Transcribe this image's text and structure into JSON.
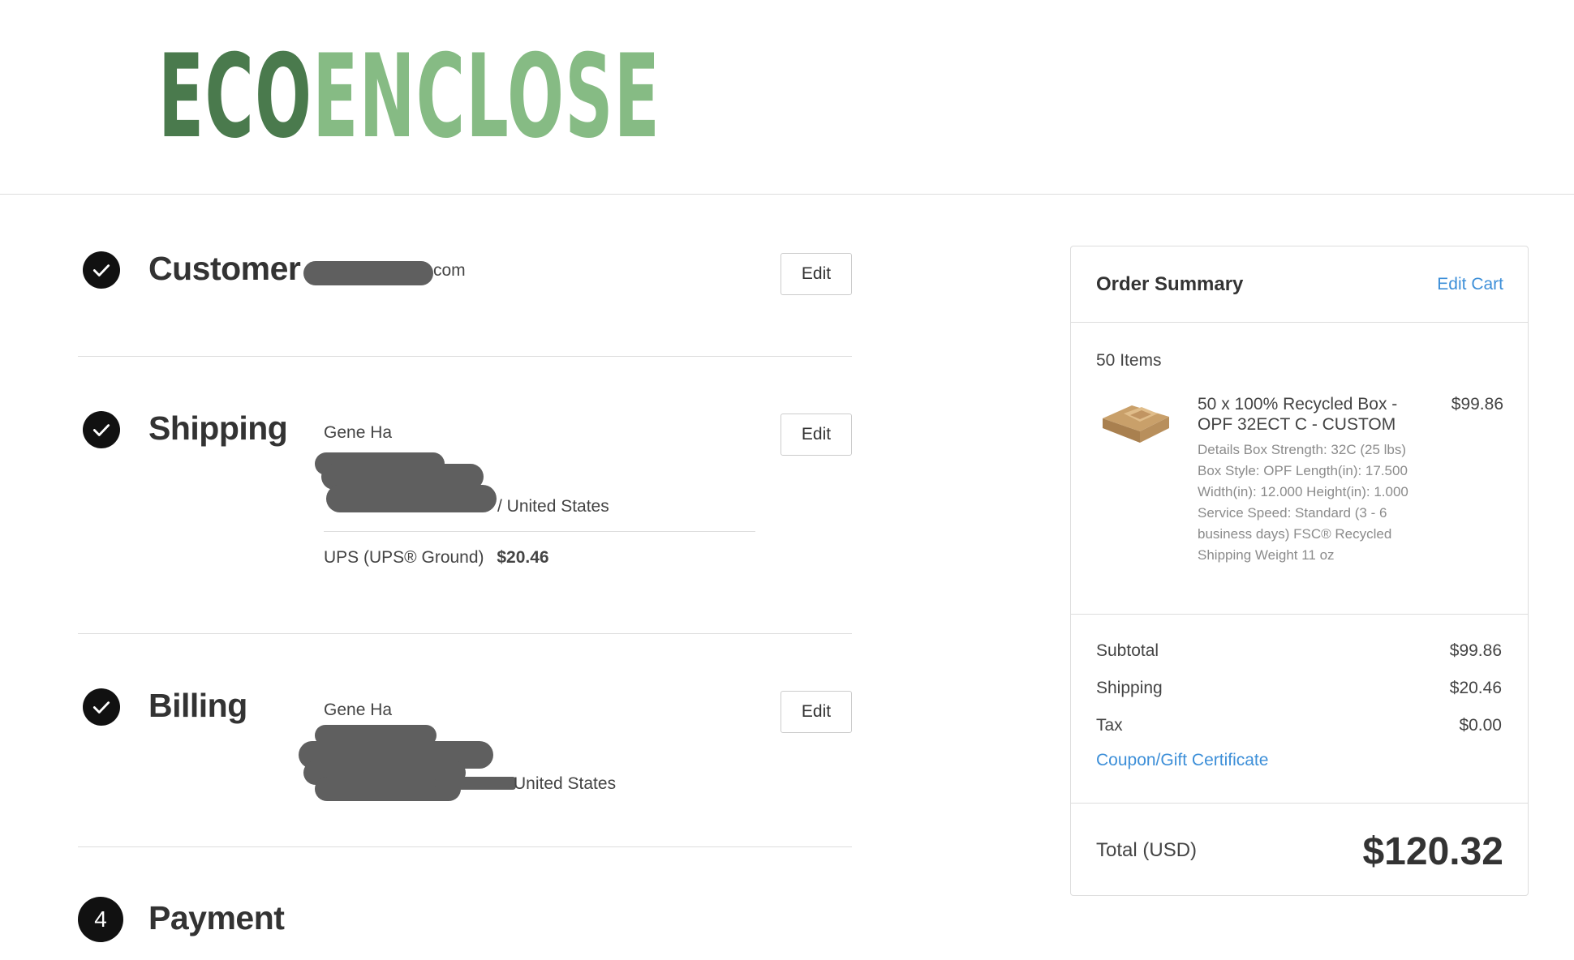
{
  "brand": {
    "logo_part1": "ECO",
    "logo_part2": "ENCLOSE"
  },
  "steps": {
    "customer": {
      "title": "Customer",
      "email_visible_suffix": "com",
      "edit_label": "Edit"
    },
    "shipping": {
      "title": "Shipping",
      "name": "Gene Ha",
      "address_country_suffix": "/ United States",
      "method": "UPS (UPS® Ground)",
      "method_price": "$20.46",
      "edit_label": "Edit"
    },
    "billing": {
      "title": "Billing",
      "name": "Gene Ha",
      "address_country_suffix": "United States",
      "edit_label": "Edit"
    },
    "payment": {
      "number": "4",
      "title": "Payment"
    }
  },
  "summary": {
    "title": "Order Summary",
    "edit_cart_label": "Edit Cart",
    "items_count": "50 Items",
    "item": {
      "name": "50 x 100% Recycled Box - OPF 32ECT C - CUSTOM",
      "price": "$99.86",
      "details": "Details Box Strength: 32C (25 lbs) Box Style: OPF Length(in): 17.500 Width(in): 12.000 Height(in): 1.000 Service Speed: Standard (3 - 6 business days) FSC® Recycled Shipping Weight 11 oz"
    },
    "subtotal_label": "Subtotal",
    "subtotal": "$99.86",
    "shipping_label": "Shipping",
    "shipping": "$20.46",
    "tax_label": "Tax",
    "tax": "$0.00",
    "coupon_label": "Coupon/Gift Certificate",
    "total_label": "Total (USD)",
    "total": "$120.32"
  }
}
